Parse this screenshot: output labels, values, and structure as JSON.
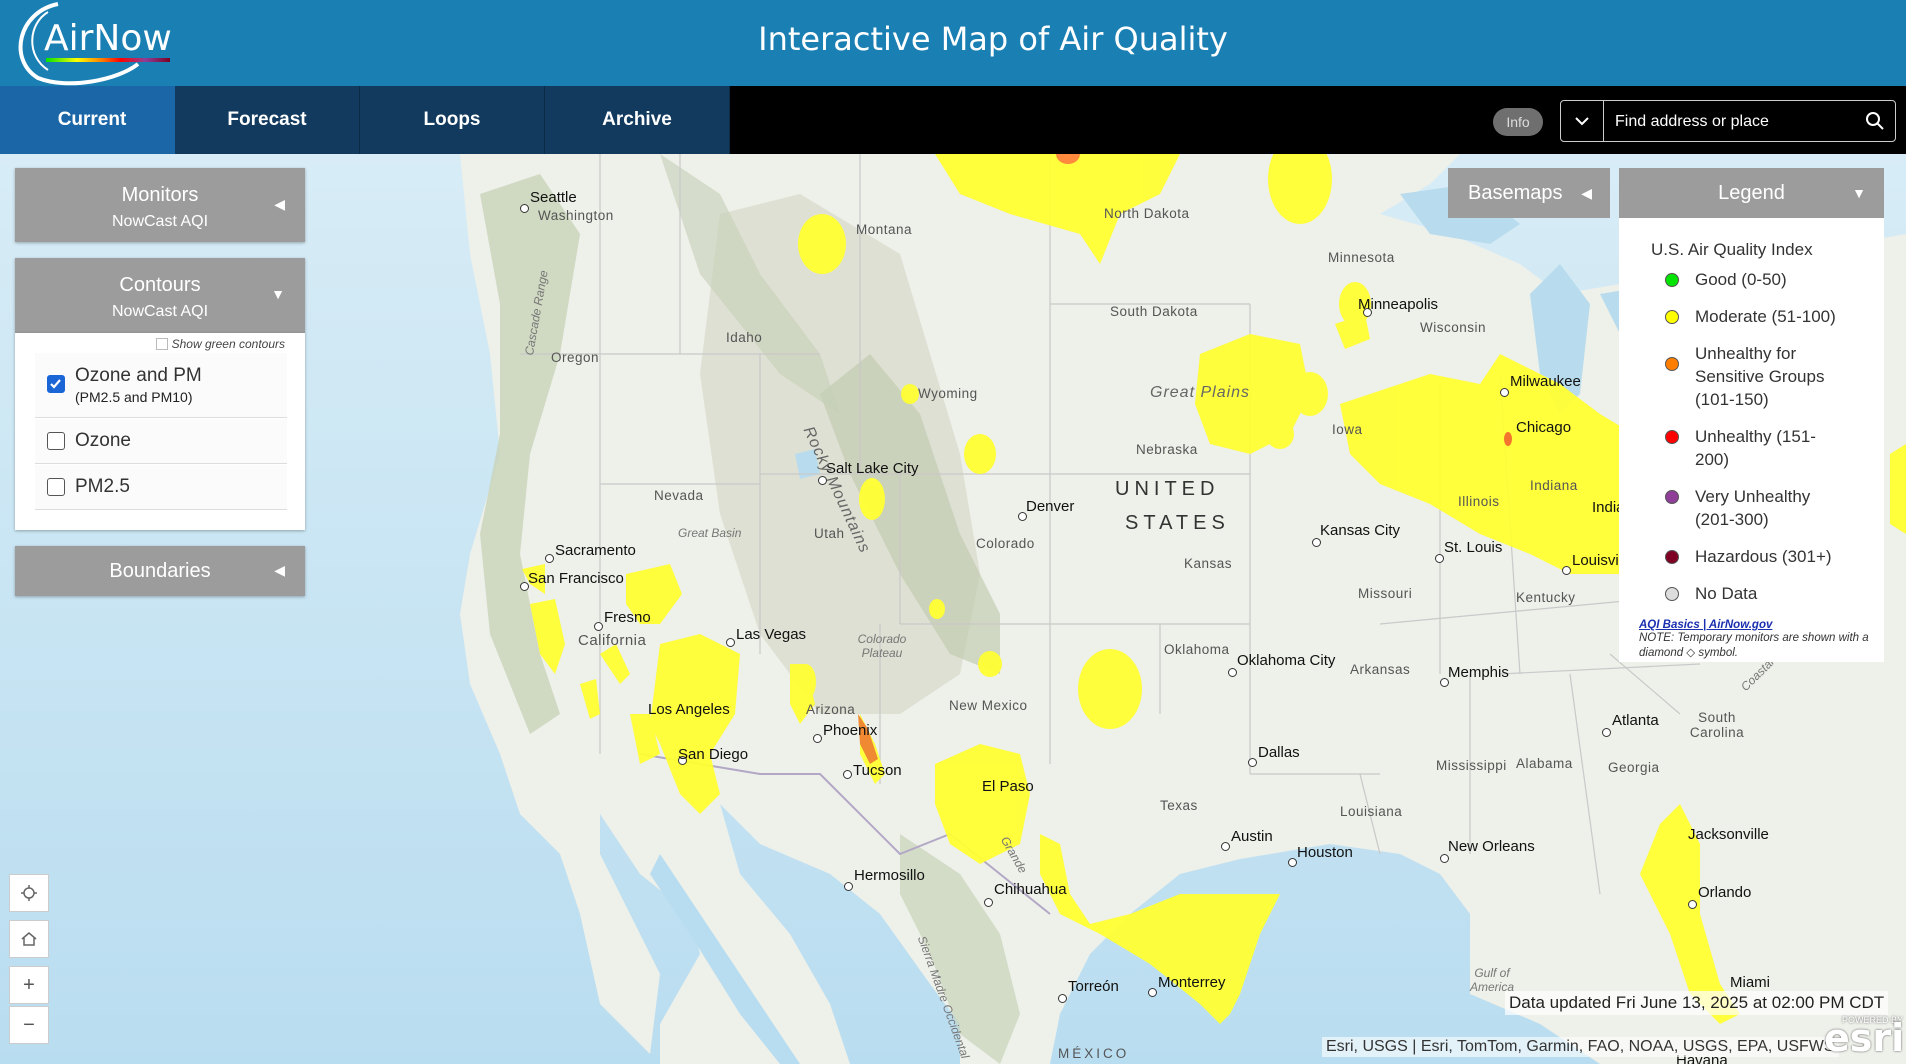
{
  "header": {
    "logo_text": "AirNow",
    "title": "Interactive Map of Air Quality"
  },
  "nav": {
    "tabs": [
      "Current",
      "Forecast",
      "Loops",
      "Archive"
    ],
    "info_label": "Info",
    "search_placeholder": "Find address or place"
  },
  "panels": {
    "monitors": {
      "title": "Monitors",
      "subtitle": "NowCast AQI"
    },
    "contours": {
      "title": "Contours",
      "subtitle": "NowCast AQI",
      "show_green": "Show green contours",
      "options": [
        {
          "label": "Ozone and PM",
          "sub": "(PM2.5 and PM10)",
          "checked": true
        },
        {
          "label": "Ozone",
          "checked": false
        },
        {
          "label": "PM2.5",
          "checked": false
        }
      ]
    },
    "boundaries": {
      "title": "Boundaries"
    }
  },
  "basemaps": {
    "label": "Basemaps"
  },
  "legend": {
    "header": "Legend",
    "title": "U.S. Air Quality Index",
    "items": [
      {
        "label": "Good (0-50)",
        "color": "#00e400"
      },
      {
        "label": "Moderate (51-100)",
        "color": "#ffff00"
      },
      {
        "label": "Unhealthy for Sensitive Groups (101-150)",
        "color": "#ff7e00"
      },
      {
        "label": "Unhealthy (151-200)",
        "color": "#ff0000"
      },
      {
        "label": "Very Unhealthy (201-300)",
        "color": "#8f3f97"
      },
      {
        "label": "Hazardous (301+)",
        "color": "#7e0023"
      },
      {
        "label": "No Data",
        "color": "#dddddd"
      }
    ],
    "link": "AQI Basics | AirNow.gov",
    "note": "NOTE: Temporary monitors are shown with a diamond ◇ symbol."
  },
  "map": {
    "country_label": [
      "UNITED",
      "STATES"
    ],
    "mexico_label": "MÉXICO",
    "cities": [
      "Seattle",
      "Sacramento",
      "San Francisco",
      "Fresno",
      "Los Angeles",
      "San Diego",
      "Las Vegas",
      "Phoenix",
      "Tucson",
      "Salt Lake City",
      "Denver",
      "El Paso",
      "Hermosillo",
      "Chihuahua",
      "Torreón",
      "Monterrey",
      "Oklahoma City",
      "Dallas",
      "Austin",
      "Houston",
      "Kansas City",
      "St. Louis",
      "Memphis",
      "Minneapolis",
      "Milwaukee",
      "Chicago",
      "Indianapolis",
      "Louisville",
      "Atlanta",
      "New Orleans",
      "Jacksonville",
      "Orlando",
      "Miami",
      "Havana"
    ],
    "states": [
      "Washington",
      "Oregon",
      "California",
      "Idaho",
      "Nevada",
      "Montana",
      "Wyoming",
      "Utah",
      "Arizona",
      "Colorado",
      "New Mexico",
      "North Dakota",
      "South Dakota",
      "Nebraska",
      "Kansas",
      "Oklahoma",
      "Texas",
      "Minnesota",
      "Iowa",
      "Missouri",
      "Arkansas",
      "Louisiana",
      "Wisconsin",
      "Illinois",
      "Indiana",
      "Kentucky",
      "Mississippi",
      "Alabama",
      "Georgia",
      "South Carolina"
    ],
    "regions": [
      "Great Plains",
      "Rocky Mountains",
      "Great Basin",
      "Cascade Range",
      "Colorado Plateau",
      "Sierra Madre Occidental",
      "Gulf of America",
      "Coastal Plain",
      "Grande"
    ]
  },
  "tools": [
    "locate-icon",
    "home-icon",
    "zoom-in-icon",
    "zoom-out-icon"
  ],
  "footer": {
    "updated": "Data updated Fri June 13, 2025 at 02:00 PM CDT",
    "attribution": "Esri, USGS | Esri, TomTom, Garmin, FAO, NOAA, USGS, EPA, USFWS",
    "esri": "esri",
    "powered_by": "POWERED BY"
  }
}
